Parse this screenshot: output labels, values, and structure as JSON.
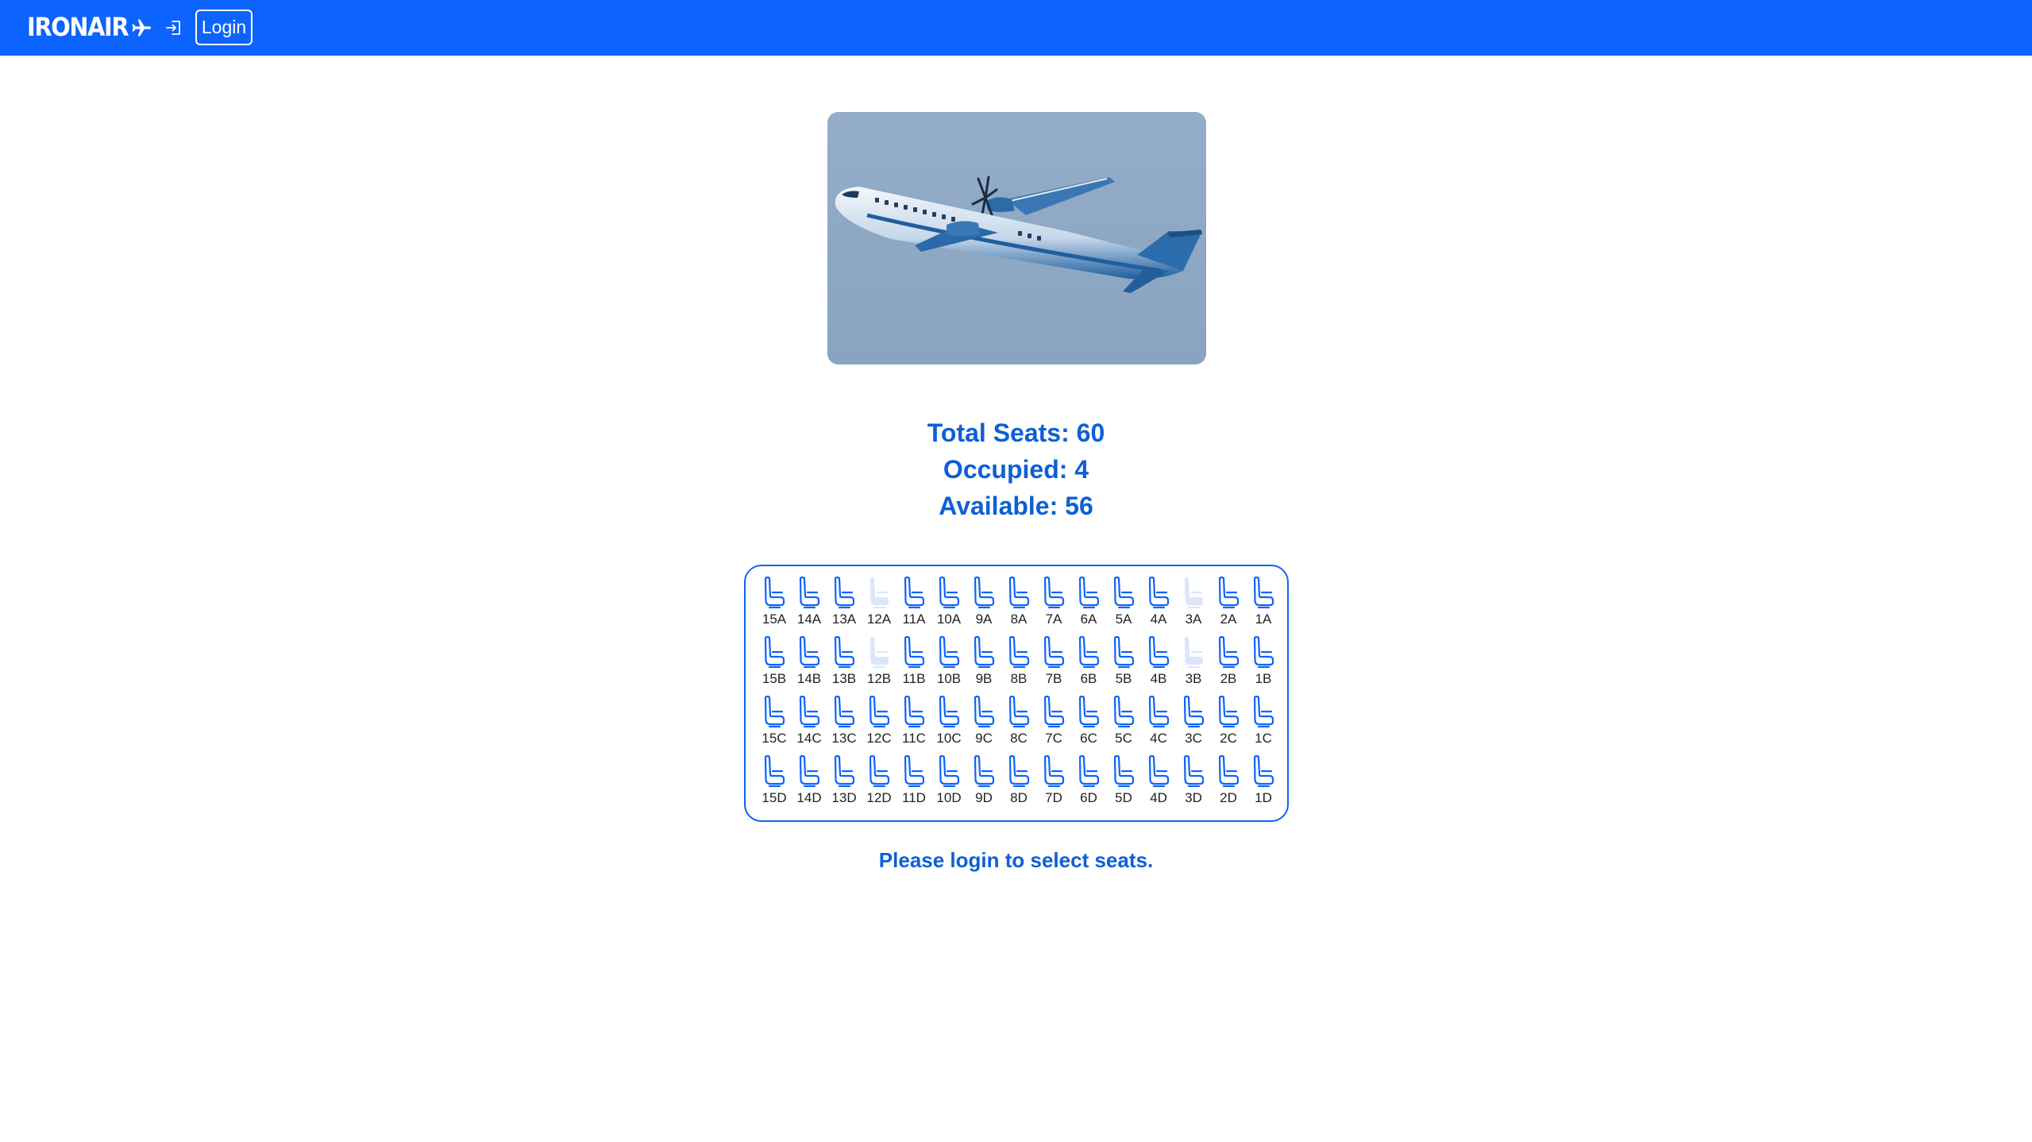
{
  "navbar": {
    "brand": "IRONAIR",
    "login_label": "Login",
    "icons": [
      "airplane-icon",
      "login-icon"
    ]
  },
  "colors": {
    "primary": "#0d63fd",
    "text_blue": "#0d5fd6",
    "seat_available": "#0d63fd",
    "seat_occupied": "#dce5fb"
  },
  "hero_image": {
    "alt": "airplane"
  },
  "stats": {
    "total": "Total Seats: 60",
    "occupied": "Occupied: 4",
    "available": "Available: 56"
  },
  "seatmap": {
    "rows": [
      [
        {
          "id": "15A",
          "occupied": false
        },
        {
          "id": "14A",
          "occupied": false
        },
        {
          "id": "13A",
          "occupied": false
        },
        {
          "id": "12A",
          "occupied": true
        },
        {
          "id": "11A",
          "occupied": false
        },
        {
          "id": "10A",
          "occupied": false
        },
        {
          "id": "9A",
          "occupied": false
        },
        {
          "id": "8A",
          "occupied": false
        },
        {
          "id": "7A",
          "occupied": false
        },
        {
          "id": "6A",
          "occupied": false
        },
        {
          "id": "5A",
          "occupied": false
        },
        {
          "id": "4A",
          "occupied": false
        },
        {
          "id": "3A",
          "occupied": true
        },
        {
          "id": "2A",
          "occupied": false
        },
        {
          "id": "1A",
          "occupied": false
        }
      ],
      [
        {
          "id": "15B",
          "occupied": false
        },
        {
          "id": "14B",
          "occupied": false
        },
        {
          "id": "13B",
          "occupied": false
        },
        {
          "id": "12B",
          "occupied": true
        },
        {
          "id": "11B",
          "occupied": false
        },
        {
          "id": "10B",
          "occupied": false
        },
        {
          "id": "9B",
          "occupied": false
        },
        {
          "id": "8B",
          "occupied": false
        },
        {
          "id": "7B",
          "occupied": false
        },
        {
          "id": "6B",
          "occupied": false
        },
        {
          "id": "5B",
          "occupied": false
        },
        {
          "id": "4B",
          "occupied": false
        },
        {
          "id": "3B",
          "occupied": true
        },
        {
          "id": "2B",
          "occupied": false
        },
        {
          "id": "1B",
          "occupied": false
        }
      ],
      [
        {
          "id": "15C",
          "occupied": false
        },
        {
          "id": "14C",
          "occupied": false
        },
        {
          "id": "13C",
          "occupied": false
        },
        {
          "id": "12C",
          "occupied": false
        },
        {
          "id": "11C",
          "occupied": false
        },
        {
          "id": "10C",
          "occupied": false
        },
        {
          "id": "9C",
          "occupied": false
        },
        {
          "id": "8C",
          "occupied": false
        },
        {
          "id": "7C",
          "occupied": false
        },
        {
          "id": "6C",
          "occupied": false
        },
        {
          "id": "5C",
          "occupied": false
        },
        {
          "id": "4C",
          "occupied": false
        },
        {
          "id": "3C",
          "occupied": false
        },
        {
          "id": "2C",
          "occupied": false
        },
        {
          "id": "1C",
          "occupied": false
        }
      ],
      [
        {
          "id": "15D",
          "occupied": false
        },
        {
          "id": "14D",
          "occupied": false
        },
        {
          "id": "13D",
          "occupied": false
        },
        {
          "id": "12D",
          "occupied": false
        },
        {
          "id": "11D",
          "occupied": false
        },
        {
          "id": "10D",
          "occupied": false
        },
        {
          "id": "9D",
          "occupied": false
        },
        {
          "id": "8D",
          "occupied": false
        },
        {
          "id": "7D",
          "occupied": false
        },
        {
          "id": "6D",
          "occupied": false
        },
        {
          "id": "5D",
          "occupied": false
        },
        {
          "id": "4D",
          "occupied": false
        },
        {
          "id": "3D",
          "occupied": false
        },
        {
          "id": "2D",
          "occupied": false
        },
        {
          "id": "1D",
          "occupied": false
        }
      ]
    ]
  },
  "message": "Please login to select seats."
}
